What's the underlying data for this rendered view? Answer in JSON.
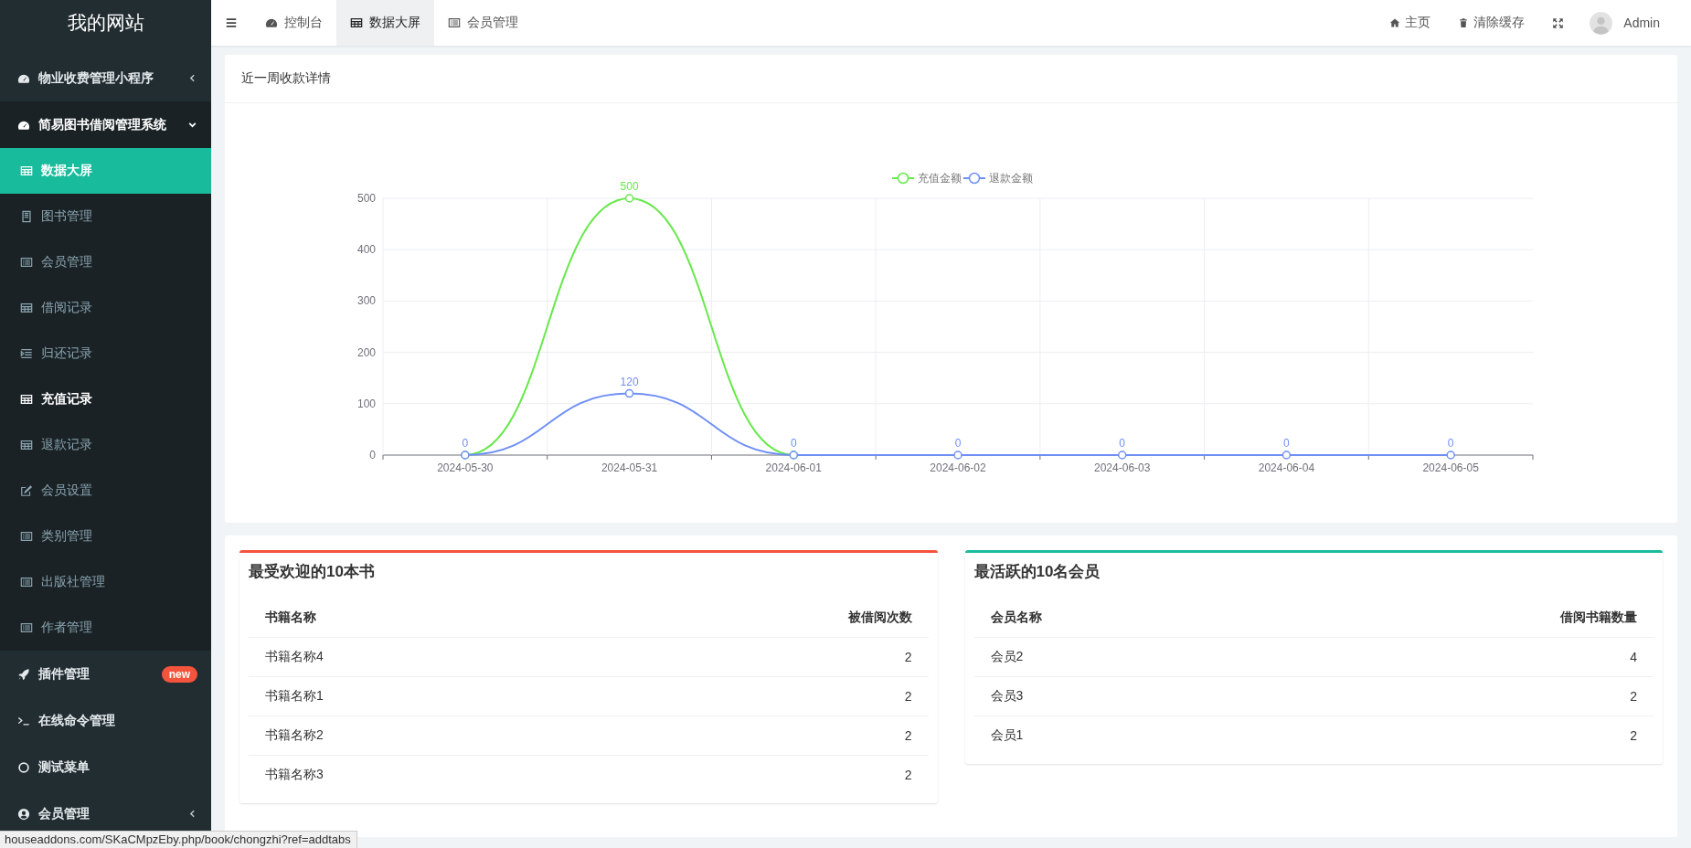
{
  "sidebar": {
    "logo": "我的网站",
    "items": [
      {
        "label": "物业收费管理小程序",
        "expanded": false
      },
      {
        "label": "简易图书借阅管理系统",
        "expanded": true,
        "children": [
          {
            "label": "数据大屏",
            "selected": true,
            "highlighted": false
          },
          {
            "label": "图书管理",
            "selected": false,
            "highlighted": false
          },
          {
            "label": "会员管理",
            "selected": false,
            "highlighted": false
          },
          {
            "label": "借阅记录",
            "selected": false,
            "highlighted": false
          },
          {
            "label": "归还记录",
            "selected": false,
            "highlighted": false
          },
          {
            "label": "充值记录",
            "selected": false,
            "highlighted": true
          },
          {
            "label": "退款记录",
            "selected": false,
            "highlighted": false
          },
          {
            "label": "会员设置",
            "selected": false,
            "highlighted": false
          },
          {
            "label": "类别管理",
            "selected": false,
            "highlighted": false
          },
          {
            "label": "出版社管理",
            "selected": false,
            "highlighted": false
          },
          {
            "label": "作者管理",
            "selected": false,
            "highlighted": false
          }
        ]
      },
      {
        "label": "插件管理",
        "badge": "new"
      },
      {
        "label": "在线命令管理"
      },
      {
        "label": "测试菜单"
      },
      {
        "label": "会员管理",
        "expanded": false
      }
    ]
  },
  "topbar": {
    "tabs": [
      {
        "label": "控制台",
        "selected": false
      },
      {
        "label": "数据大屏",
        "selected": true
      },
      {
        "label": "会员管理",
        "selected": false
      }
    ],
    "links": [
      {
        "label": "主页"
      },
      {
        "label": "清除缓存"
      }
    ],
    "user": "Admin"
  },
  "chart_panel": {
    "title": "近一周收款详情",
    "chart_data": {
      "type": "line",
      "categories": [
        "2024-05-30",
        "2024-05-31",
        "2024-06-01",
        "2024-06-02",
        "2024-06-03",
        "2024-06-04",
        "2024-06-05"
      ],
      "series": [
        {
          "name": "充值金额",
          "color": "#66e94a",
          "marker": "circle",
          "values": [
            0,
            500,
            0,
            null,
            null,
            null,
            null
          ]
        },
        {
          "name": "退款金额",
          "color": "#6f8ff5",
          "marker": "circle",
          "values": [
            0,
            120,
            0,
            0,
            0,
            0,
            0
          ]
        }
      ],
      "ylim": [
        0,
        500
      ],
      "yticks": [
        0,
        100,
        200,
        300,
        400,
        500
      ],
      "grid": true,
      "legend": "top",
      "value_labels": [
        [
          null,
          "500",
          null,
          null,
          null,
          null,
          null
        ],
        [
          "0",
          "120",
          "0",
          "0",
          "0",
          "0",
          "0"
        ]
      ]
    }
  },
  "rankings": [
    {
      "title": "最受欢迎的10本书",
      "color": "#f4543c",
      "columns": [
        "书籍名称",
        "被借阅次数"
      ],
      "rows": [
        [
          "书籍名称4",
          "2"
        ],
        [
          "书籍名称1",
          "2"
        ],
        [
          "书籍名称2",
          "2"
        ],
        [
          "书籍名称3",
          "2"
        ]
      ]
    },
    {
      "title": "最活跃的10名会员",
      "color": "#18bc9c",
      "columns": [
        "会员名称",
        "借阅书籍数量"
      ],
      "rows": [
        [
          "会员2",
          "4"
        ],
        [
          "会员3",
          "2"
        ],
        [
          "会员1",
          "2"
        ]
      ]
    }
  ],
  "status_bar": {
    "url": "houseaddons.com/SKaCMpzEby.php/book/chongzhi?ref=addtabs"
  }
}
